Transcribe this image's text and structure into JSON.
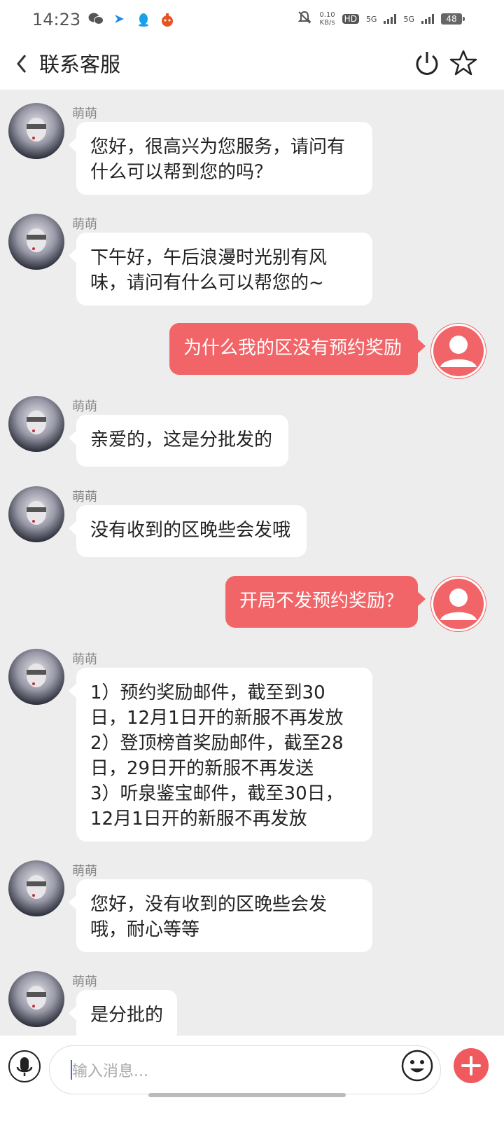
{
  "status": {
    "time": "14:23",
    "net_speed_value": "0.10",
    "net_speed_unit": "KB/s",
    "hd": "HD",
    "sim1": "5G",
    "sim2": "5G",
    "battery": "48"
  },
  "header": {
    "title": "联系客服"
  },
  "agent": {
    "name": "萌萌"
  },
  "messages": [
    {
      "text": "您好，很高兴为您服务，请问有什么可以帮到您的吗？"
    },
    {
      "text": "下午好，午后浪漫时光别有风味，请问有什么可以帮您的~"
    },
    {
      "text": "为什么我的区没有预约奖励"
    },
    {
      "text": "亲爱的，这是分批发的"
    },
    {
      "text": "没有收到的区晚些会发哦"
    },
    {
      "text": "开局不发预约奖励？"
    },
    {
      "lines": [
        "1）预约奖励邮件，截至到30",
        "日，12月1日开的新服不再发放",
        "2）登顶榜首奖励邮件，截至28",
        "日，29日开的新服不再发送",
        "3）听泉鉴宝邮件，截至30日，",
        "12月1日开的新服不再发放"
      ]
    },
    {
      "text": "您好，没有收到的区晚些会发哦，耐心等等"
    },
    {
      "text": "是分批的"
    }
  ],
  "input": {
    "placeholder": "输入消息..."
  },
  "colors": {
    "accent": "#f16568",
    "background": "#ededed",
    "bubble": "#ffffff"
  }
}
